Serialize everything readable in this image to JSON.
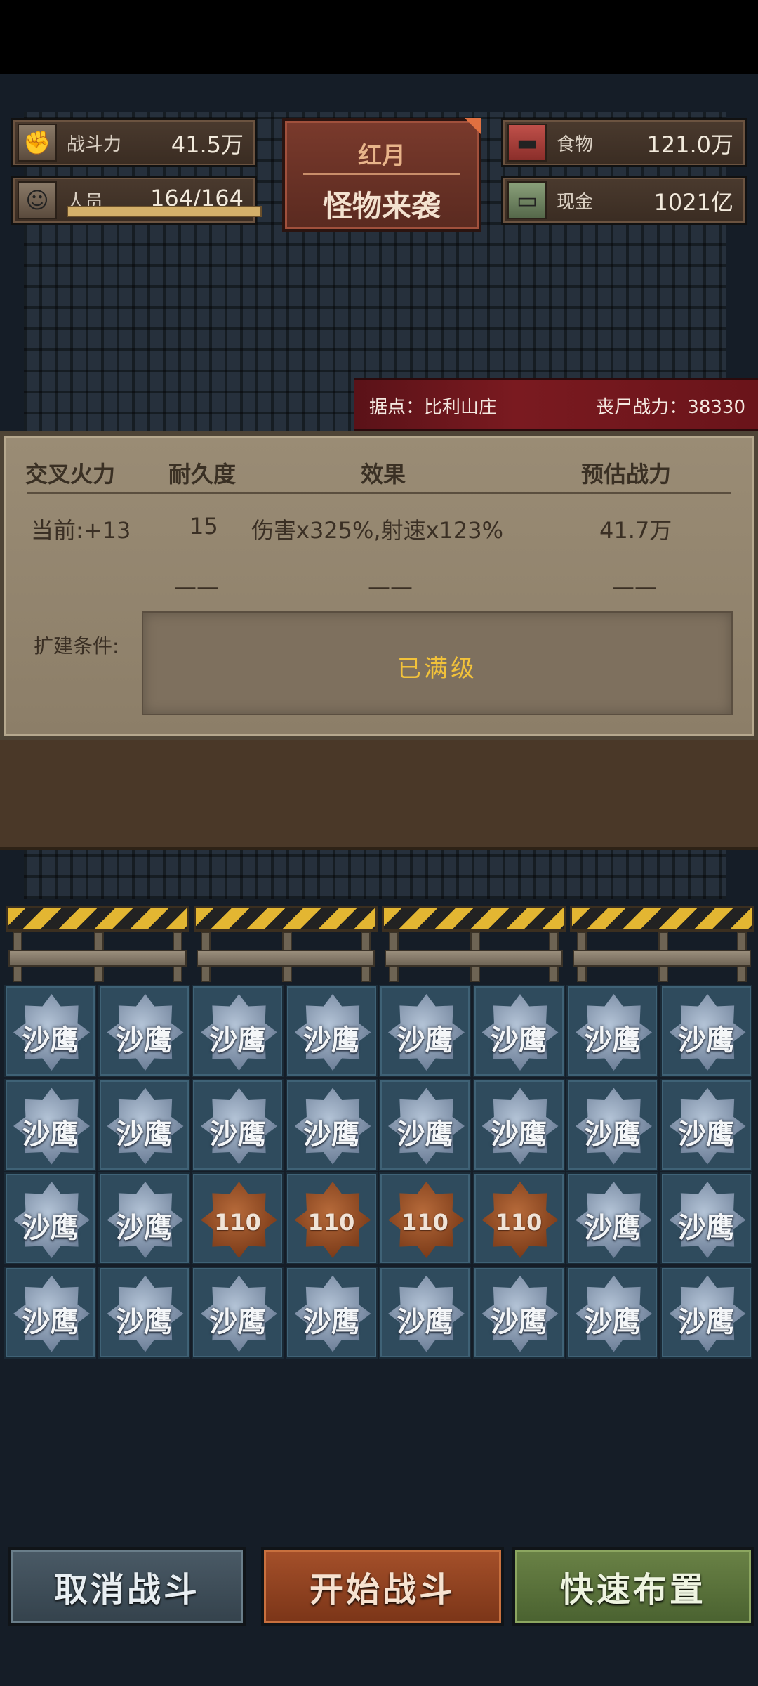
{
  "header": {
    "power": {
      "label": "战斗力",
      "value": "41.5万",
      "icon": "fist-icon"
    },
    "crew": {
      "label": "人员",
      "value": "164/164",
      "icon": "person-icon",
      "fill": 1.0
    },
    "food": {
      "label": "食物",
      "value": "121.0万",
      "icon": "meat-icon"
    },
    "cash": {
      "label": "现金",
      "value": "1021亿",
      "icon": "cash-icon"
    },
    "event": {
      "line1": "红月",
      "line2": "怪物来袭"
    }
  },
  "stronghold": {
    "base": "据点：比利山庄",
    "zombie_power": "丧尸战力：38330"
  },
  "panel": {
    "headers": [
      "交叉火力",
      "耐久度",
      "效果",
      "预估战力"
    ],
    "current": {
      "level": "当前:+13",
      "durability": "15",
      "effect": "伤害x325%,射速x123%",
      "power": "41.7万"
    },
    "next": {
      "durability": "——",
      "effect": "——",
      "power": "——"
    },
    "condition_label": "扩建条件:",
    "condition_value": "已满级"
  },
  "grid": {
    "unit_label": "沙鹰",
    "special_label": "110",
    "rows": [
      [
        "沙鹰",
        "沙鹰",
        "沙鹰",
        "沙鹰",
        "沙鹰",
        "沙鹰",
        "沙鹰",
        "沙鹰"
      ],
      [
        "沙鹰",
        "沙鹰",
        "沙鹰",
        "沙鹰",
        "沙鹰",
        "沙鹰",
        "沙鹰",
        "沙鹰"
      ],
      [
        "沙鹰",
        "沙鹰",
        "110",
        "110",
        "110",
        "110",
        "沙鹰",
        "沙鹰"
      ],
      [
        "沙鹰",
        "沙鹰",
        "沙鹰",
        "沙鹰",
        "沙鹰",
        "沙鹰",
        "沙鹰",
        "沙鹰"
      ]
    ]
  },
  "buttons": {
    "cancel": "取消战斗",
    "start": "开始战斗",
    "quick": "快速布置"
  }
}
